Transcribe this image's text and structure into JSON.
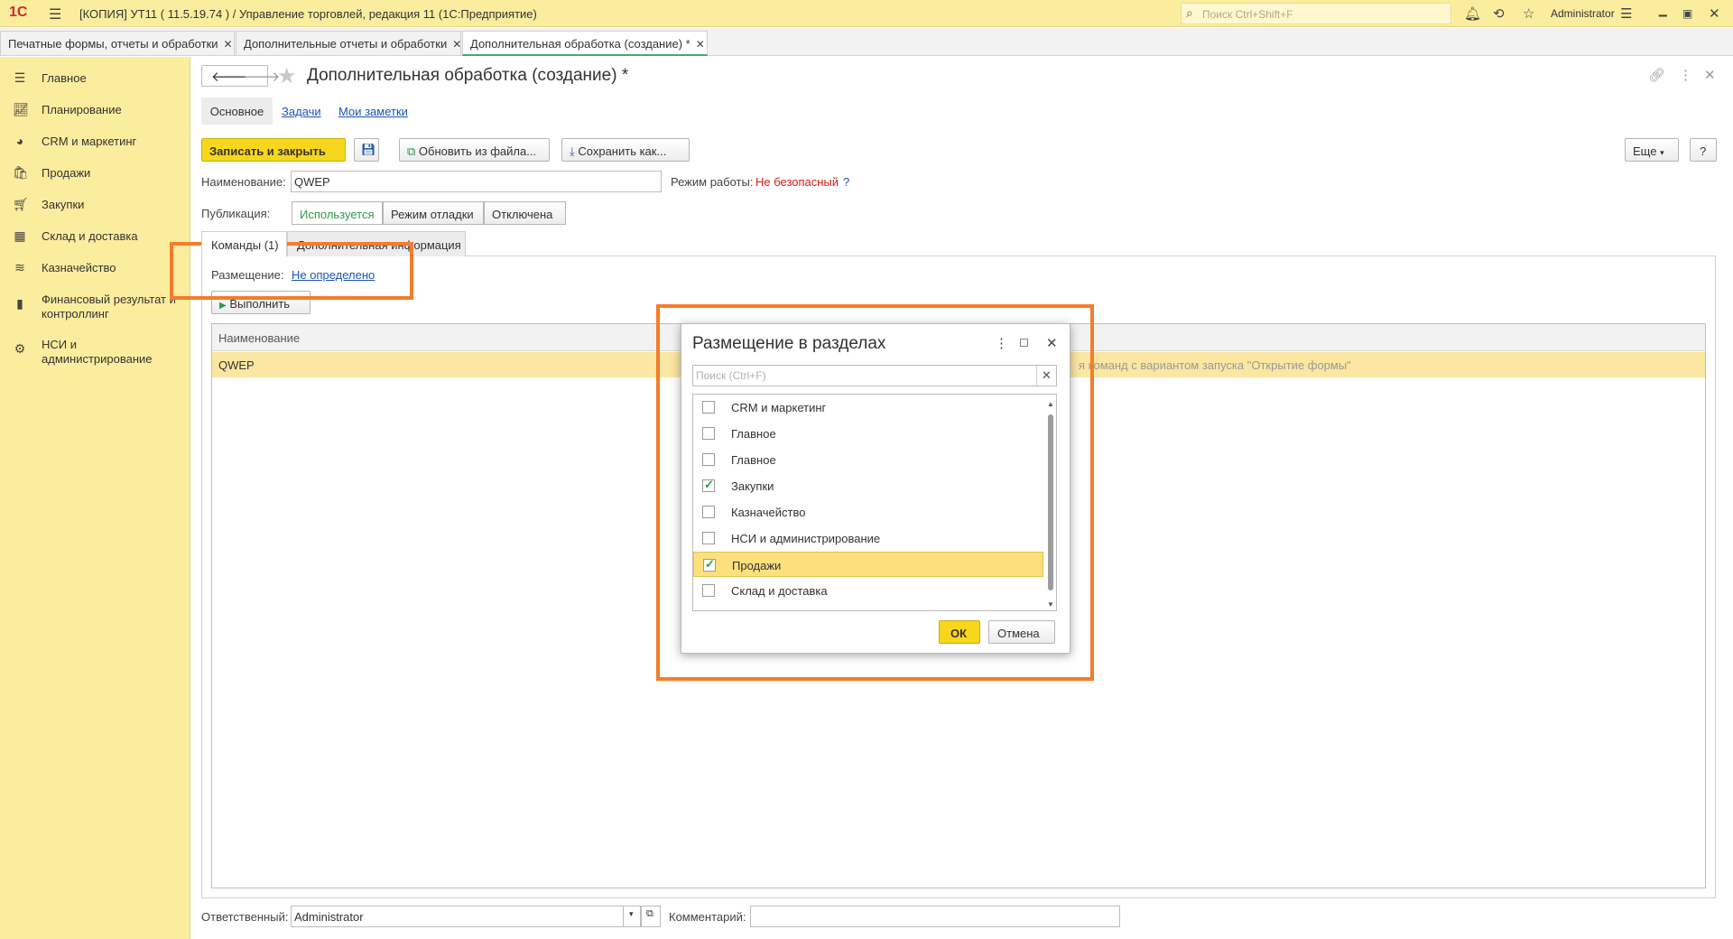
{
  "titlebar": {
    "logo": "1С",
    "title": "[КОПИЯ] УТ11 (          11.5.19.74          ) / Управление торговлей, редакция 11  (1С:Предприятие)",
    "search_placeholder": "Поиск Ctrl+Shift+F",
    "user": "Administrator"
  },
  "tabs": [
    {
      "label": "Печатные формы, отчеты и обработки"
    },
    {
      "label": "Дополнительные отчеты и обработки"
    },
    {
      "label": "Дополнительная обработка (создание) *"
    }
  ],
  "sidebar": {
    "items": [
      {
        "label": "Главное",
        "icon": "menu-icon"
      },
      {
        "label": "Планирование",
        "icon": "chart-icon"
      },
      {
        "label": "CRM и маркетинг",
        "icon": "pie-icon"
      },
      {
        "label": "Продажи",
        "icon": "bag-icon"
      },
      {
        "label": "Закупки",
        "icon": "cart-icon"
      },
      {
        "label": "Склад и доставка",
        "icon": "grid-icon"
      },
      {
        "label": "Казначейство",
        "icon": "coins-icon"
      },
      {
        "label": "Финансовый результат и контроллинг",
        "icon": "bars-icon"
      },
      {
        "label": "НСИ и администрирование",
        "icon": "gear-icon"
      }
    ]
  },
  "form": {
    "title": "Дополнительная обработка (создание) *",
    "subtabs": {
      "main": "Основное",
      "tasks": "Задачи",
      "notes": "Мои заметки"
    },
    "toolbar": {
      "save_close": "Записать и закрыть",
      "update_file": "Обновить из файла...",
      "save_as": "Сохранить как...",
      "more": "Еще",
      "help": "?"
    },
    "name_label": "Наименование:",
    "name_value": "QWEP",
    "mode_label": "Режим работы:",
    "mode_value": "Не безопасный",
    "mode_help": "?",
    "publication_label": "Публикация:",
    "publication_options": {
      "used": "Используется",
      "debug": "Режим отладки",
      "off": "Отключена"
    },
    "panel_tabs": {
      "commands": "Команды (1)",
      "extra": "Дополнительная информация"
    },
    "placement_label": "Размещение:",
    "placement_value": "Не определено",
    "run_button": "Выполнить",
    "grid": {
      "header": "Наименование",
      "row_name": "QWEP",
      "row_note": "я команд с вариантом запуска \"Открытие формы\""
    },
    "responsible_label": "Ответственный:",
    "responsible_value": "Administrator",
    "comment_label": "Комментарий:",
    "comment_value": ""
  },
  "modal": {
    "title": "Размещение в разделах",
    "search_placeholder": "Поиск (Ctrl+F)",
    "items": [
      {
        "label": "CRM и маркетинг",
        "checked": false
      },
      {
        "label": "Главное",
        "checked": false
      },
      {
        "label": "Главное",
        "checked": false
      },
      {
        "label": "Закупки",
        "checked": true
      },
      {
        "label": "Казначейство",
        "checked": false
      },
      {
        "label": "НСИ и администрирование",
        "checked": false
      },
      {
        "label": "Продажи",
        "checked": true
      },
      {
        "label": "Склад и доставка",
        "checked": false
      }
    ],
    "ok": "ОК",
    "cancel": "Отмена"
  },
  "colors": {
    "accent": "#f8d61c",
    "sidebar": "#fbed9e",
    "annotation": "#f57c2b",
    "check": "#2c9b45"
  }
}
